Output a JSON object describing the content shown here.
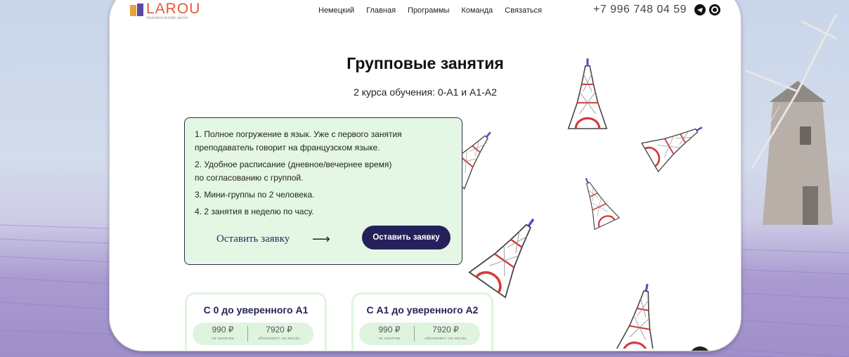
{
  "brand": {
    "name": "LAROU",
    "tagline": "ЯЗЫКОВАЯ ОНЛАЙН ШКОЛА"
  },
  "nav": {
    "items": [
      "Немецкий",
      "Главная",
      "Программы",
      "Команда",
      "Связаться"
    ]
  },
  "header": {
    "phone": "+7 996 748 04 59"
  },
  "hero": {
    "title": "Групповые занятия",
    "subtitle": "2 курса обучения: 0-А1 и А1-А2"
  },
  "features": [
    "1. Полное погружение в язык. Уже с первого занятия\n    преподаватель говорит на французском языке.",
    "2. Удобное расписание (дневное/вечернее время)\n    по согласованию с группой.",
    "3. Мини-группы по 2 человека.",
    "4. 2 занятия в неделю по часу."
  ],
  "actions": {
    "link_label": "Оставить заявку",
    "arrow": "⟶",
    "button_label": "Оставить заявку"
  },
  "courses": [
    {
      "title": "С 0 до уверенного А1",
      "price_lesson": "990 ₽",
      "price_lesson_label": "за занятие",
      "price_month": "7920 ₽",
      "price_month_label": "абонемент на месяц"
    },
    {
      "title": "С А1 до уверенного А2",
      "price_lesson": "990 ₽",
      "price_lesson_label": "за занятие",
      "price_month": "7920 ₽",
      "price_month_label": "абонемент на месяц"
    }
  ],
  "colors": {
    "accent": "#24205a",
    "card_bg": "#e4f7e4",
    "brand_orange": "#e05a3a",
    "tower_red": "#d23a3a"
  },
  "icons": {
    "social_1": "telegram-icon",
    "social_2": "vk-icon"
  }
}
